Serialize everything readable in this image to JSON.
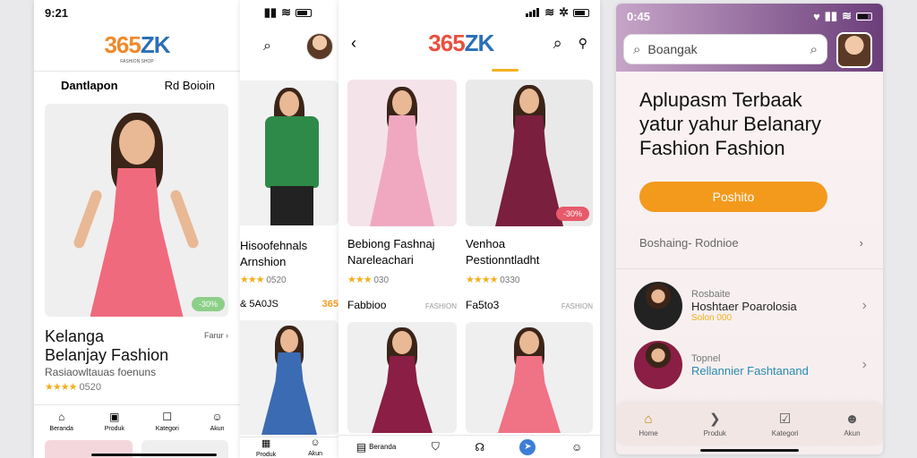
{
  "brand": {
    "logo_num": "365",
    "logo_txt": "ZK",
    "logo_sub": "FASHION SHOP"
  },
  "s1": {
    "time": "9:21",
    "tab_left": "Dantlapon",
    "tab_right": "Rd Boioin",
    "hero_badge": "-30%",
    "hero_title_1": "Kelanga",
    "hero_title_2": "Belanjay Fashion",
    "hero_sub": "Rasiaowltauas foenuns",
    "hero_link": "Farur",
    "rating": "0520",
    "nav": [
      "Beranda",
      "Produk",
      "Kategori",
      "Akun"
    ]
  },
  "s2": {
    "prod1_name_1": "Hisoofehnals",
    "prod1_name_2": "Arnshion",
    "prod1_rating": "0520",
    "row_label": "& 5A0JS",
    "row_price": "365",
    "nav": [
      "Produk",
      "Akun"
    ]
  },
  "s3": {
    "p1_name_1": "Bebiong Fashnaj",
    "p1_name_2": "Nareleachari",
    "p1_rating": "030",
    "p2_name_1": "Venhoa",
    "p2_name_2": "Pestionntladht",
    "p2_rating": "0330",
    "p2_badge": "-30%",
    "row1_left": "Fabbioo",
    "row1_right": "FASHION",
    "row2_left": "Fa5to3",
    "row2_right": "FASHION",
    "nav": [
      "Beranda",
      "",
      "",
      "",
      ""
    ]
  },
  "s4": {
    "time": "0:45",
    "search_value": "Boangak",
    "hero_l1": "Aplupasm Terbaak",
    "hero_l2": "yatur yahur Belanary",
    "hero_l3": "Fashion Fashion",
    "cta": "Poshito",
    "section": "Boshaing- Rodnioe",
    "items": [
      {
        "t1": "Rosbaite",
        "t2": "Hoshtaer Poarolosia",
        "t3": "Solon 000",
        "color": "#222222"
      },
      {
        "t1": "Topnel",
        "t2": "Rellannier Fashtanand",
        "t3": "",
        "color": "#2a8ab0"
      }
    ],
    "nav": [
      "Home",
      "Produk",
      "Kategori",
      "Akun"
    ]
  },
  "colors": {
    "accent": "#f39a1d",
    "brand_purple": "#6b3e7a"
  }
}
